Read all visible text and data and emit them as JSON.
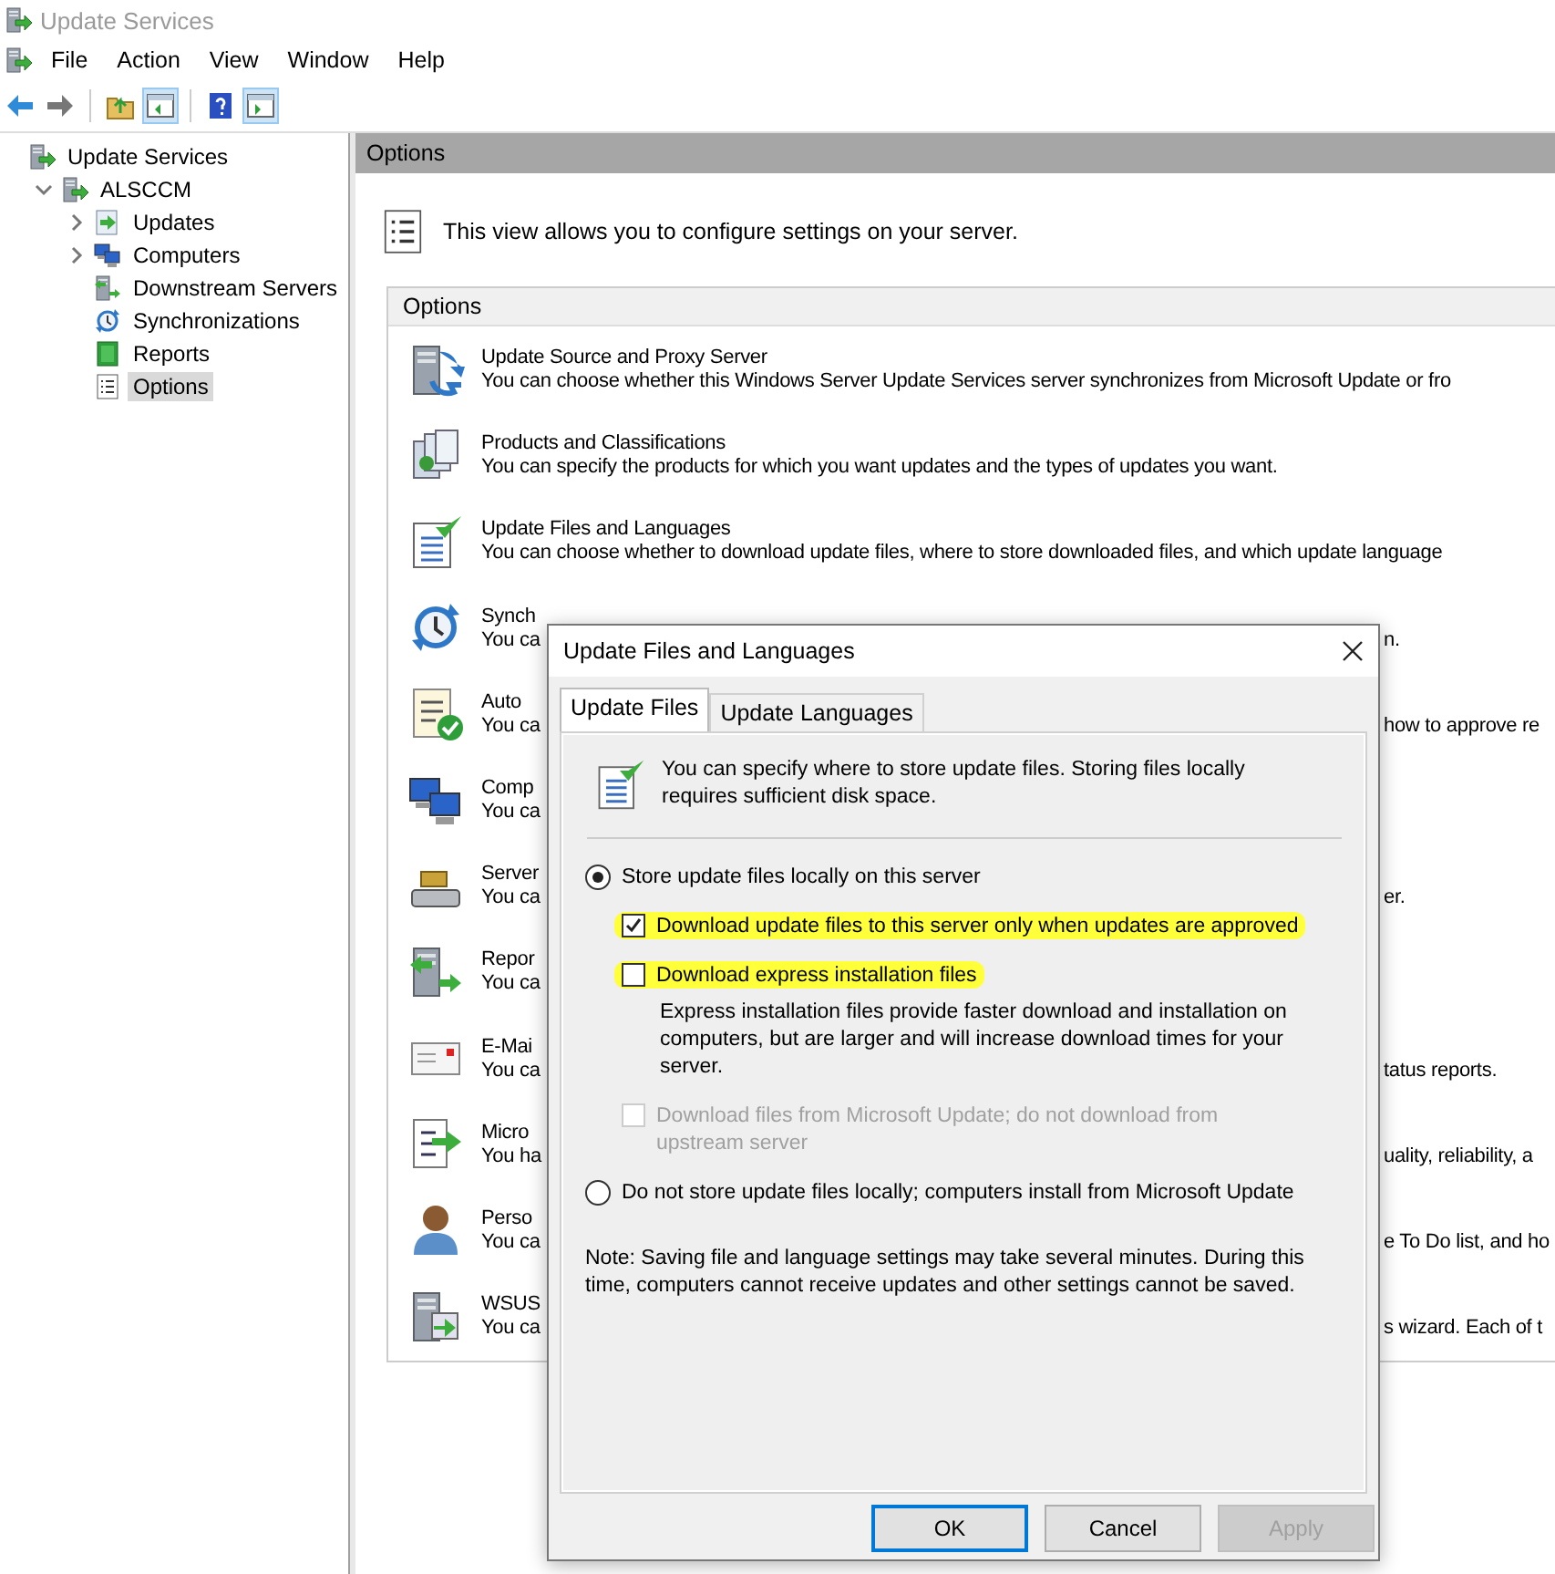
{
  "window": {
    "title": "Update Services"
  },
  "menu": [
    "File",
    "Action",
    "View",
    "Window",
    "Help"
  ],
  "tree": [
    {
      "label": "Update Services",
      "kind": "server",
      "selected": false,
      "children": [
        {
          "label": "ALSCCM",
          "kind": "server",
          "expanded": true,
          "selected": false,
          "children": [
            {
              "label": "Updates",
              "kind": "updates",
              "expanded": false,
              "selected": false
            },
            {
              "label": "Computers",
              "kind": "computers",
              "expanded": false,
              "selected": false
            },
            {
              "label": "Downstream Servers",
              "kind": "downstream",
              "selected": false
            },
            {
              "label": "Synchronizations",
              "kind": "sync",
              "selected": false
            },
            {
              "label": "Reports",
              "kind": "reports",
              "selected": false
            },
            {
              "label": "Options",
              "kind": "options",
              "selected": true
            }
          ]
        }
      ]
    }
  ],
  "pane": {
    "title": "Options",
    "intro": "This view allows you to configure settings on your server.",
    "section": "Options",
    "items": [
      {
        "kind": "source",
        "title": "Update Source and Proxy Server",
        "desc": "You can choose whether this Windows Server Update Services server synchronizes from Microsoft Update or fro"
      },
      {
        "kind": "products",
        "title": "Products and Classifications",
        "desc": "You can specify the products for which you want updates and the types of updates you want."
      },
      {
        "kind": "files",
        "title": "Update Files and Languages",
        "desc": "You can choose whether to download update files, where to store downloaded files, and which update language"
      },
      {
        "kind": "sync",
        "title": "Synch",
        "desc": "You ca",
        "desc_right": "n."
      },
      {
        "kind": "approvals",
        "title": "Auto",
        "desc": "You ca",
        "desc_right": "how to approve re"
      },
      {
        "kind": "computers",
        "title": "Comp",
        "desc": "You ca"
      },
      {
        "kind": "cleanup",
        "title": "Server",
        "desc": "You ca",
        "desc_right": "er."
      },
      {
        "kind": "reporting",
        "title": "Repor",
        "desc": "You ca"
      },
      {
        "kind": "email",
        "title": "E-Mai",
        "desc": "You ca",
        "desc_right": "tatus reports."
      },
      {
        "kind": "improvement",
        "title": "Micro",
        "desc": "You ha",
        "desc_right": "uality, reliability, a"
      },
      {
        "kind": "person",
        "title": "Perso",
        "desc": "You ca",
        "desc_right": "e To Do list, and ho"
      },
      {
        "kind": "wizard",
        "title": "WSUS",
        "desc": "You ca",
        "desc_right": "s wizard. Each of t"
      }
    ]
  },
  "dialog": {
    "title": "Update Files and Languages",
    "tabs": [
      {
        "label": "Update Files",
        "selected": true
      },
      {
        "label": "Update Languages",
        "selected": false
      }
    ],
    "intro": "You can specify where to store update files. Storing files locally requires sufficient disk space.",
    "options": [
      {
        "kind": "radio",
        "label": "Store update files locally on this server",
        "selected": true,
        "highlighted": false
      },
      {
        "kind": "checkbox",
        "label": "Download update files to this server only when updates are approved",
        "checked": true,
        "disabled": false,
        "highlighted": true
      },
      {
        "kind": "checkbox",
        "label": "Download express installation files",
        "checked": false,
        "disabled": false,
        "highlighted": true,
        "description": "Express installation files provide faster download and installation on computers, but are larger and will increase download times for your server."
      },
      {
        "kind": "checkbox",
        "label": "Download files from Microsoft Update; do not download from upstream server",
        "checked": false,
        "disabled": true,
        "highlighted": false
      },
      {
        "kind": "radio",
        "label": "Do not store update files locally; computers install from Microsoft Update",
        "selected": false,
        "highlighted": false
      }
    ],
    "note": "Note: Saving file and language settings may take several minutes. During this time, computers cannot receive updates and other settings cannot be saved.",
    "buttons": [
      {
        "label": "OK",
        "default": true,
        "disabled": false
      },
      {
        "label": "Cancel",
        "default": false,
        "disabled": false
      },
      {
        "label": "Apply",
        "default": false,
        "disabled": true
      }
    ]
  }
}
